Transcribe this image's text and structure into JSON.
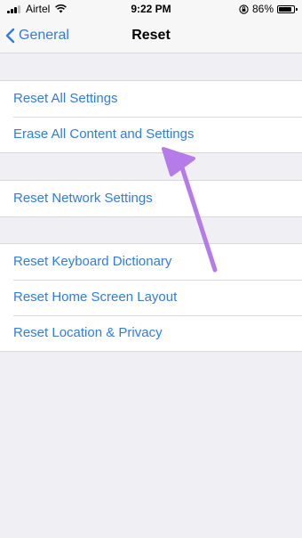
{
  "status_bar": {
    "carrier": "Airtel",
    "time": "9:22 PM",
    "battery": "86%",
    "battery_level": 0.86,
    "icons": [
      "signal-icon",
      "wifi-icon",
      "orientation-lock-icon",
      "battery-icon"
    ]
  },
  "nav": {
    "back_label": "General",
    "title": "Reset"
  },
  "groups": [
    {
      "items": [
        "Reset All Settings",
        "Erase All Content and Settings"
      ]
    },
    {
      "items": [
        "Reset Network Settings"
      ]
    },
    {
      "items": [
        "Reset Keyboard Dictionary",
        "Reset Home Screen Layout",
        "Reset Location & Privacy"
      ]
    }
  ],
  "colors": {
    "link": "#2f7de1",
    "background": "#efeff4",
    "annotation_arrow": "#b57be8"
  }
}
